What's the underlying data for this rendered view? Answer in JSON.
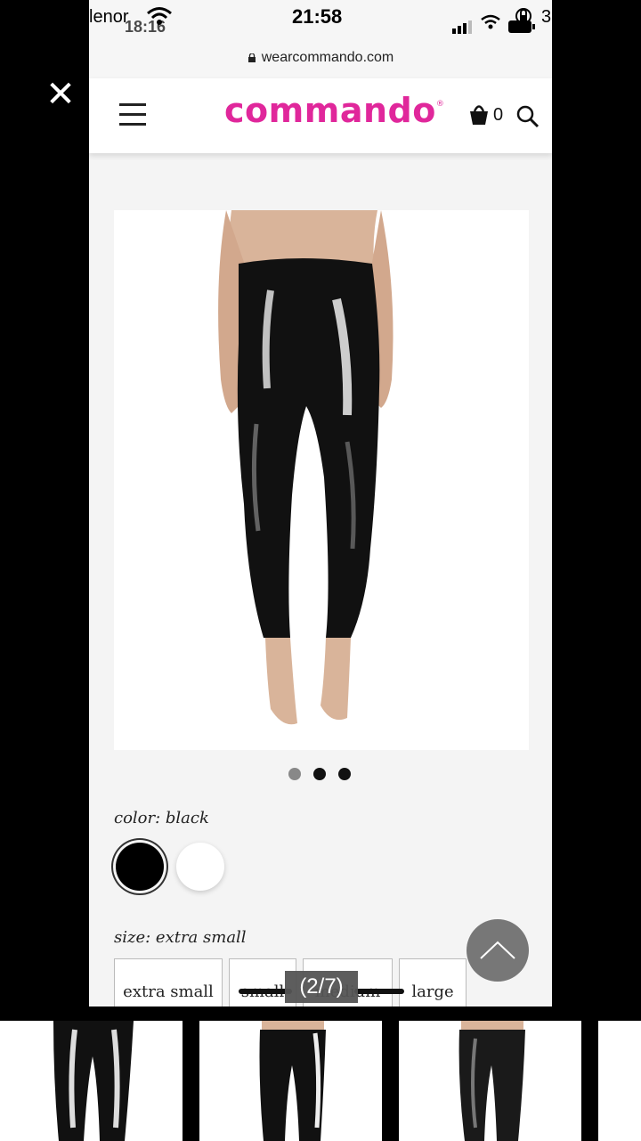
{
  "viewer": {
    "close_glyph": "✕",
    "counter": "(2/7)"
  },
  "status_bar": {
    "carrier": "lenor",
    "time_behind": "18:16",
    "time": "21:58",
    "battery_text": "3"
  },
  "browser": {
    "url": "wearcommando.com"
  },
  "header": {
    "logo": "commando",
    "trademark": "®",
    "cart_count": "0"
  },
  "carousel": {
    "slides": 3,
    "active_index": 0
  },
  "color": {
    "label": "color: black",
    "options": [
      "black",
      "white"
    ],
    "selected": "black"
  },
  "size": {
    "label": "size: extra small",
    "buttons": [
      "extra small",
      "small",
      "medium",
      "large"
    ],
    "selected": "extra small"
  },
  "colors": {
    "brand": "#e0279b",
    "page_bg": "#f4f4f4"
  }
}
